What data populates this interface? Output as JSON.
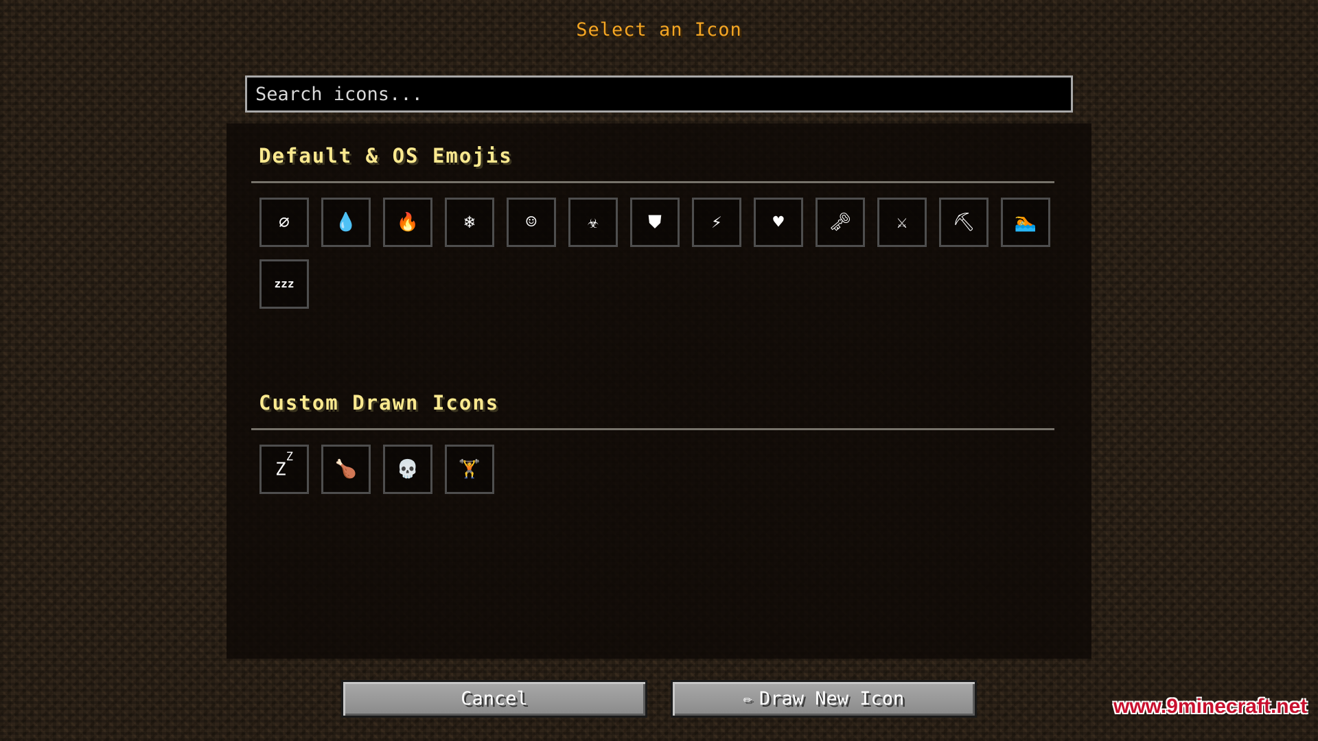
{
  "screen_title": "Select an Icon",
  "search": {
    "placeholder": "Search icons..."
  },
  "sections": [
    {
      "title": "Default & OS Emojis",
      "icons": [
        {
          "glyph": "∅",
          "name": "null-icon"
        },
        {
          "glyph": "💧",
          "name": "water-drop-icon"
        },
        {
          "glyph": "🔥",
          "name": "fire-icon"
        },
        {
          "glyph": "❄",
          "name": "snowflake-icon"
        },
        {
          "glyph": "☺",
          "name": "face-icon"
        },
        {
          "glyph": "☣",
          "name": "biohazard-icon"
        },
        {
          "glyph": "⛊",
          "name": "shield-icon"
        },
        {
          "glyph": "⚡",
          "name": "lightning-icon"
        },
        {
          "glyph": "♥",
          "name": "heart-icon"
        },
        {
          "glyph": "🗝",
          "name": "key-icon"
        },
        {
          "glyph": "⚔",
          "name": "crossed-swords-icon"
        },
        {
          "glyph": "⛏",
          "name": "pickaxe-icon"
        },
        {
          "glyph": "🏊",
          "name": "swimmer-icon"
        },
        {
          "glyph": "zzz",
          "name": "sleep-zzz-icon"
        }
      ]
    },
    {
      "title": "Custom Drawn Icons",
      "icons": [
        {
          "glyph": "Z",
          "glyph_sup": "Z",
          "name": "sleep-z-icon"
        },
        {
          "glyph": "🍗",
          "name": "food-icon"
        },
        {
          "glyph": "💀",
          "name": "skull-icon"
        },
        {
          "glyph": "🏋",
          "name": "dumbbell-icon"
        }
      ]
    }
  ],
  "buttons": {
    "cancel": "Cancel",
    "draw_new_icon": "Draw New Icon",
    "draw_new_icon_glyph": "✏"
  },
  "watermark": "www.9minecraft.net",
  "colors": {
    "title": "#f5a623",
    "section_title": "#fbe98f",
    "button_face": "#9a9a9a",
    "watermark": "#c8102e"
  }
}
